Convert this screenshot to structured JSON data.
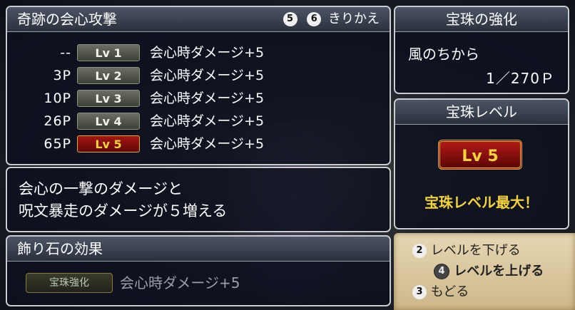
{
  "skill_panel": {
    "title": "奇跡の会心攻撃",
    "switch": {
      "key_a": "5",
      "key_b": "6",
      "label": "きりかえ"
    },
    "rows": [
      {
        "cost": "--",
        "level": "Lv 1",
        "effect": "会心時ダメージ+5",
        "active": false
      },
      {
        "cost": "3P",
        "level": "Lv 2",
        "effect": "会心時ダメージ+5",
        "active": false
      },
      {
        "cost": "10P",
        "level": "Lv 3",
        "effect": "会心時ダメージ+5",
        "active": false
      },
      {
        "cost": "26P",
        "level": "Lv 4",
        "effect": "会心時ダメージ+5",
        "active": false
      },
      {
        "cost": "65P",
        "level": "Lv 5",
        "effect": "会心時ダメージ+5",
        "active": true
      }
    ]
  },
  "description": {
    "line1": "会心の一撃のダメージと",
    "line2": "呪文暴走のダメージが５増える"
  },
  "ornament_panel": {
    "title": "飾り石の効果",
    "badge": "宝珠強化",
    "effect": "会心時ダメージ+5"
  },
  "orb_enhance": {
    "title": "宝珠の強化",
    "element": "風のちから",
    "points": "1／270Ｐ"
  },
  "orb_level": {
    "title": "宝珠レベル",
    "badge": "Lv 5",
    "status": "宝珠レベル最大！"
  },
  "controls": [
    {
      "key": "2",
      "label": "レベルを下げる",
      "style": "light"
    },
    {
      "key": "4",
      "label": "レベルを上げる",
      "style": "dark"
    },
    {
      "key": "3",
      "label": "もどる",
      "style": "light"
    }
  ],
  "colors": {
    "accent_gold": "#f5d33d",
    "active_red": "#a51614",
    "panel_border": "#c9ccd3"
  }
}
